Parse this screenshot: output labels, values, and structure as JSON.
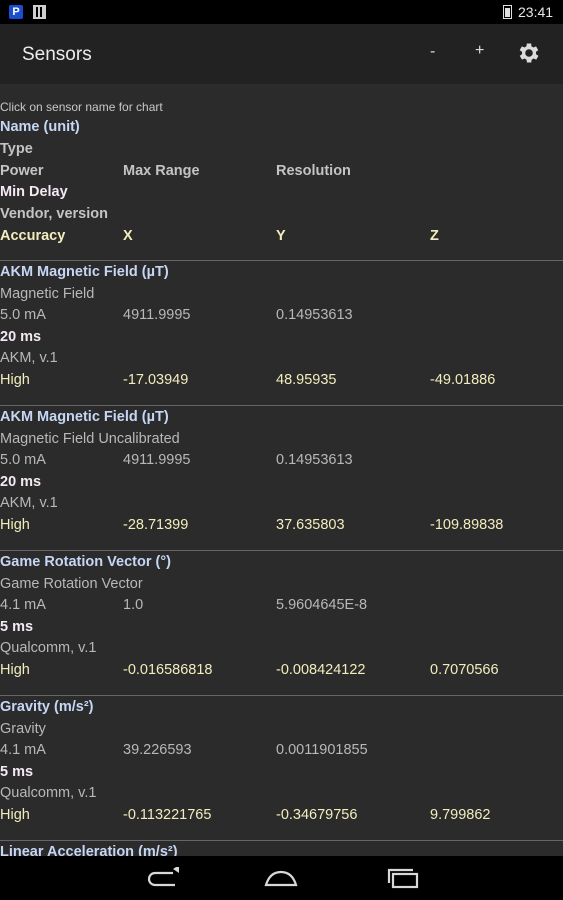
{
  "status": {
    "time": "23:41"
  },
  "toolbar": {
    "title": "Sensors",
    "zoom_out": "-",
    "zoom_in": "+"
  },
  "legend": {
    "hint": "Click on sensor name for chart",
    "name": "Name (unit)",
    "type": "Type",
    "power": "Power",
    "max_range": "Max Range",
    "resolution": "Resolution",
    "min_delay": "Min Delay",
    "vendor": "Vendor, version",
    "accuracy": "Accuracy",
    "x": "X",
    "y": "Y",
    "z": "Z"
  },
  "sensors": [
    {
      "name": "AKM Magnetic Field (µT)",
      "type": "Magnetic Field",
      "power": "5.0 mA",
      "max_range": "4911.9995",
      "resolution": "0.14953613",
      "min_delay": "20 ms",
      "vendor": "AKM, v.1",
      "accuracy": "High",
      "x": "-17.03949",
      "y": "48.95935",
      "z": "-49.01886"
    },
    {
      "name": "AKM Magnetic Field (µT)",
      "type": "Magnetic Field Uncalibrated",
      "power": "5.0 mA",
      "max_range": "4911.9995",
      "resolution": "0.14953613",
      "min_delay": "20 ms",
      "vendor": "AKM, v.1",
      "accuracy": "High",
      "x": "-28.71399",
      "y": "37.635803",
      "z": "-109.89838"
    },
    {
      "name": "Game Rotation Vector (°)",
      "type": "Game Rotation Vector",
      "power": "4.1 mA",
      "max_range": "1.0",
      "resolution": "5.9604645E-8",
      "min_delay": "5 ms",
      "vendor": "Qualcomm, v.1",
      "accuracy": "High",
      "x": "-0.016586818",
      "y": "-0.008424122",
      "z": "0.7070566"
    },
    {
      "name": "Gravity (m/s²)",
      "type": "Gravity",
      "power": "4.1 mA",
      "max_range": "39.226593",
      "resolution": "0.0011901855",
      "min_delay": "5 ms",
      "vendor": "Qualcomm, v.1",
      "accuracy": "High",
      "x": "-0.113221765",
      "y": "-0.34679756",
      "z": "9.799862"
    },
    {
      "name": "Linear Acceleration (m/s²)"
    }
  ]
}
